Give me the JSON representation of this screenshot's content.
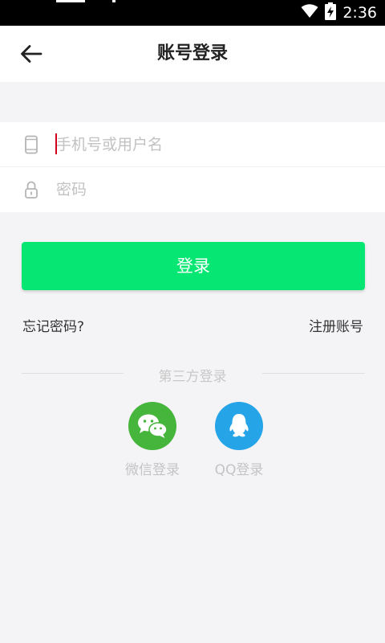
{
  "status_bar": {
    "time": "2:36",
    "icons": [
      "wifi-icon",
      "battery-charging-icon"
    ]
  },
  "header": {
    "title": "账号登录",
    "back_icon": "arrow-left-icon"
  },
  "form": {
    "username": {
      "placeholder": "手机号或用户名",
      "value": "",
      "icon": "phone-icon"
    },
    "password": {
      "placeholder": "密码",
      "value": "",
      "icon": "lock-icon"
    }
  },
  "login_button": {
    "label": "登录",
    "color": "#05e672"
  },
  "links": {
    "forgot": "忘记密码?",
    "register": "注册账号"
  },
  "third_party": {
    "heading": "第三方登录",
    "items": [
      {
        "label": "微信登录",
        "icon": "wechat-icon",
        "color": "#46b53c"
      },
      {
        "label": "QQ登录",
        "icon": "qq-icon",
        "color": "#25a4e8"
      }
    ]
  }
}
